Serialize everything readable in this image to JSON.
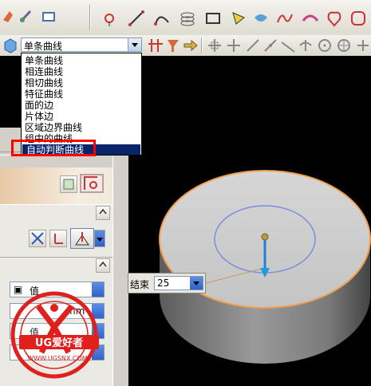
{
  "curve_rule": {
    "selected": "单条曲线",
    "options": [
      "单条曲线",
      "相连曲线",
      "相切曲线",
      "特征曲线",
      "面的边",
      "片体边",
      "区域边界曲线",
      "组中的曲线",
      "自动判断曲线"
    ],
    "highlighted": "自动判断曲线"
  },
  "panel": {
    "value_label_1": "值",
    "unit": "mm",
    "value_label_2": "值"
  },
  "end_field": {
    "label": "结束",
    "value": "25"
  },
  "watermark": {
    "brand": "UG爱好者",
    "url": "WWW.UGSNX.COM"
  },
  "colors": {
    "highlight": "#0a246a",
    "callout": "#ff0000",
    "edge": "#f29d4a",
    "circle": "#7b8ce0",
    "vector": "#1f7fd6"
  }
}
